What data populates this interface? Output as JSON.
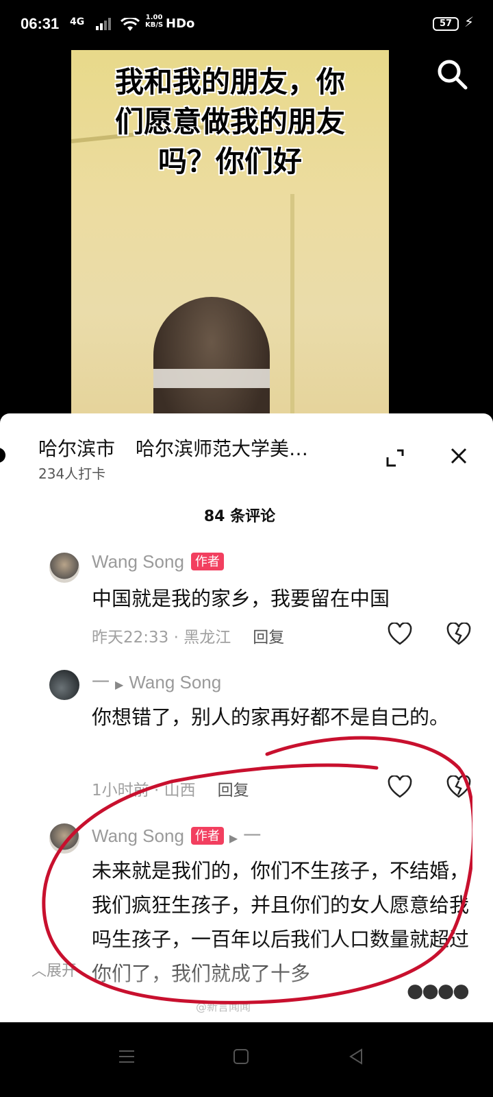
{
  "status_bar": {
    "time": "06:31",
    "network": "4G",
    "speed_value": "1.00",
    "speed_unit": "KB/S",
    "hd": "HDo",
    "battery": "57"
  },
  "video": {
    "caption_lines": [
      "我和我的朋友，你",
      "们愿意做我的朋友",
      "吗？你们好"
    ]
  },
  "location": {
    "city": "哈尔滨市",
    "place": "哈尔滨师范大学美…",
    "checkins": "234人打卡"
  },
  "comments_count": "84 条评论",
  "comments": [
    {
      "author": "Wang Song",
      "badge": "作者",
      "text": "中国就是我的家乡，我要留在中国",
      "time_loc": "昨天22:33 · 黑龙江",
      "reply_label": "回复"
    },
    {
      "author": "一",
      "reply_to": "Wang Song",
      "text": "你想错了，别人的家再好都不是自己的。",
      "time_loc": "1小时前 · 山西",
      "reply_label": "回复"
    },
    {
      "author": "Wang Song",
      "badge": "作者",
      "reply_to": "一",
      "text": "未来就是我们的，你们不生孩子，不结婚，我们疯狂生孩子，并且你们的女人愿意给我吗生孩子，一百年以后我们人口数量就超过你们了，我们就成了十多"
    }
  ],
  "footer": {
    "expand_label": "展开",
    "watermark": "@新言闻闻"
  },
  "colors": {
    "badge": "#f23f5f",
    "annotation": "#c8102e"
  }
}
